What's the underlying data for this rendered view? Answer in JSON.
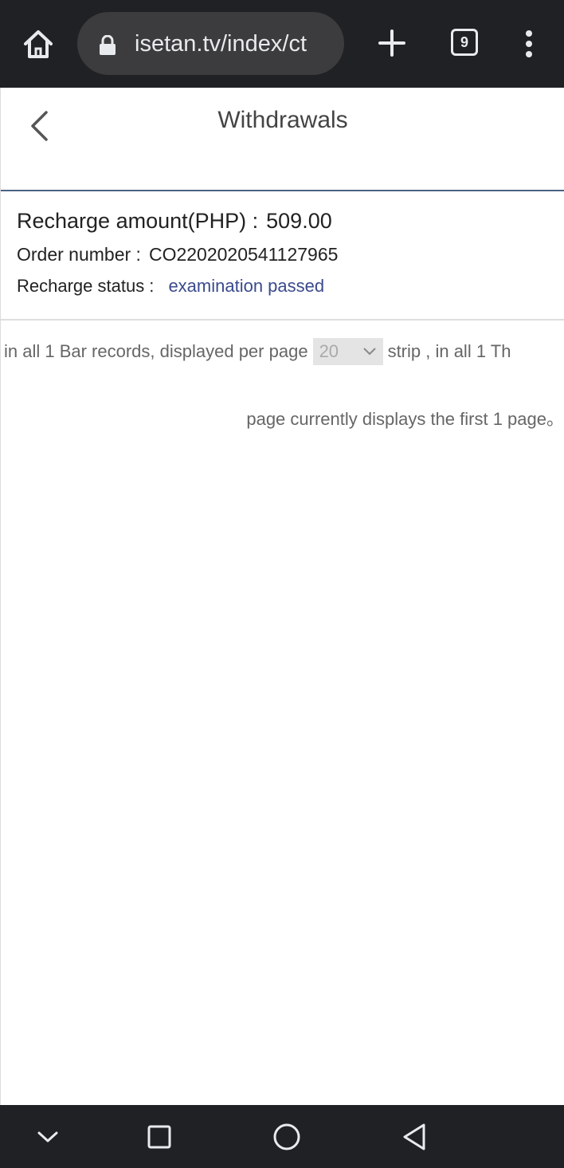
{
  "browser": {
    "url": "isetan.tv/index/ct",
    "tab_count": "9",
    "icons": [
      "home-icon",
      "lock-icon",
      "plus-icon",
      "tabs-icon",
      "more-vert-icon"
    ]
  },
  "header": {
    "title": "Withdrawals",
    "back_icon": "chevron-left-icon"
  },
  "record": {
    "amount_label": "Recharge amount(PHP) :",
    "amount_value": "509.00",
    "order_label": "Order number :",
    "order_value": "CO2202020541127965",
    "status_label": "Recharge status :",
    "status_value": "examination passed"
  },
  "pagination": {
    "prefix": "in all 1 Bar records, displayed per page",
    "per_page": "20",
    "suffix": "strip , in all 1 Th",
    "current": "page currently displays the first 1 page。"
  },
  "system_nav": {
    "icons": [
      "chevron-down-icon",
      "square-icon",
      "circle-icon",
      "triangle-back-icon"
    ]
  },
  "colors": {
    "chrome": "#202124",
    "header_border": "#4b6283",
    "status": "#3a4a8c"
  }
}
